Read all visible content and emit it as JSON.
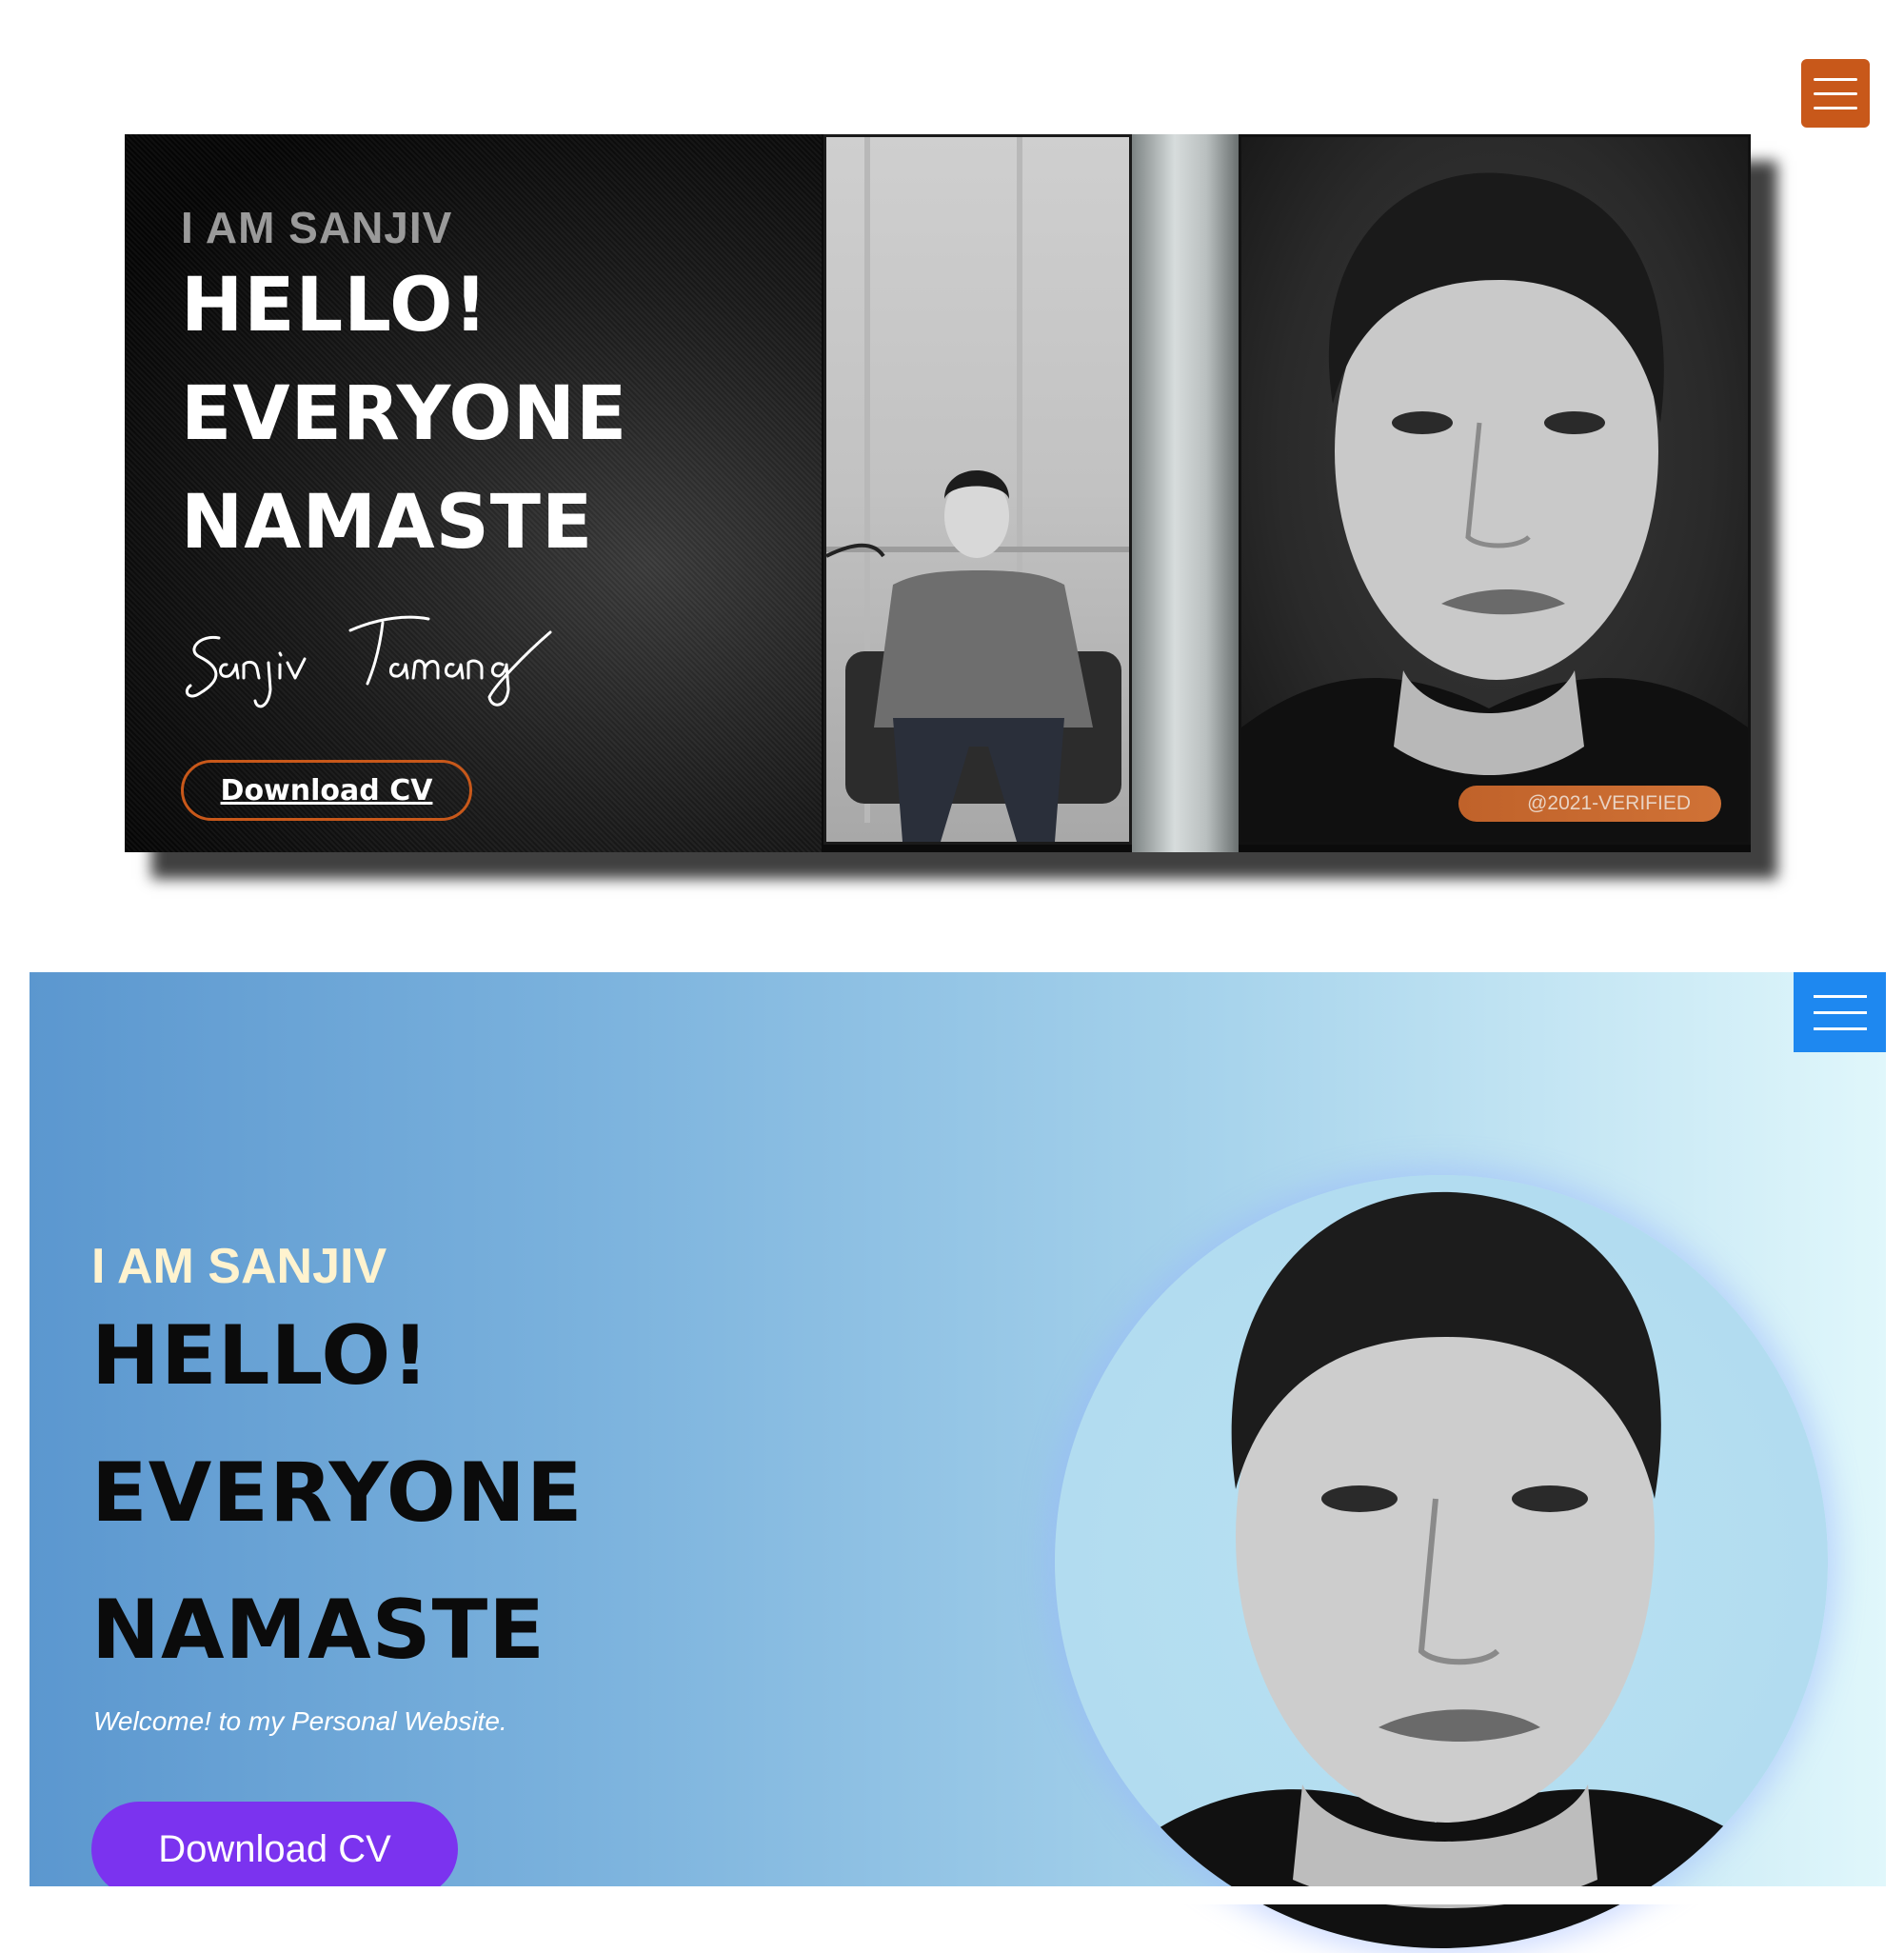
{
  "top_hero": {
    "eyebrow": "I AM SANJIV",
    "headline": [
      "HELLO!",
      "EVERYONE",
      "NAMASTE"
    ],
    "signature_text": "Sanjiv Tamang",
    "cv_button": "Download CV",
    "verified_badge": "@2021-VERIFIED",
    "menu_icon": "hamburger-icon",
    "colors": {
      "accent": "#c8581a",
      "background": "#0b0b0b"
    }
  },
  "bottom_hero": {
    "eyebrow": "I AM SANJIV",
    "headline": [
      "HELLO!",
      "EVERYONE",
      "NAMASTE"
    ],
    "welcome": "Welcome! to my Personal Website.",
    "cv_button": "Download CV",
    "menu_icon": "hamburger-icon",
    "colors": {
      "button": "#7b33ef",
      "menu": "#1e88f0",
      "eyebrow": "#fff3cf"
    }
  }
}
